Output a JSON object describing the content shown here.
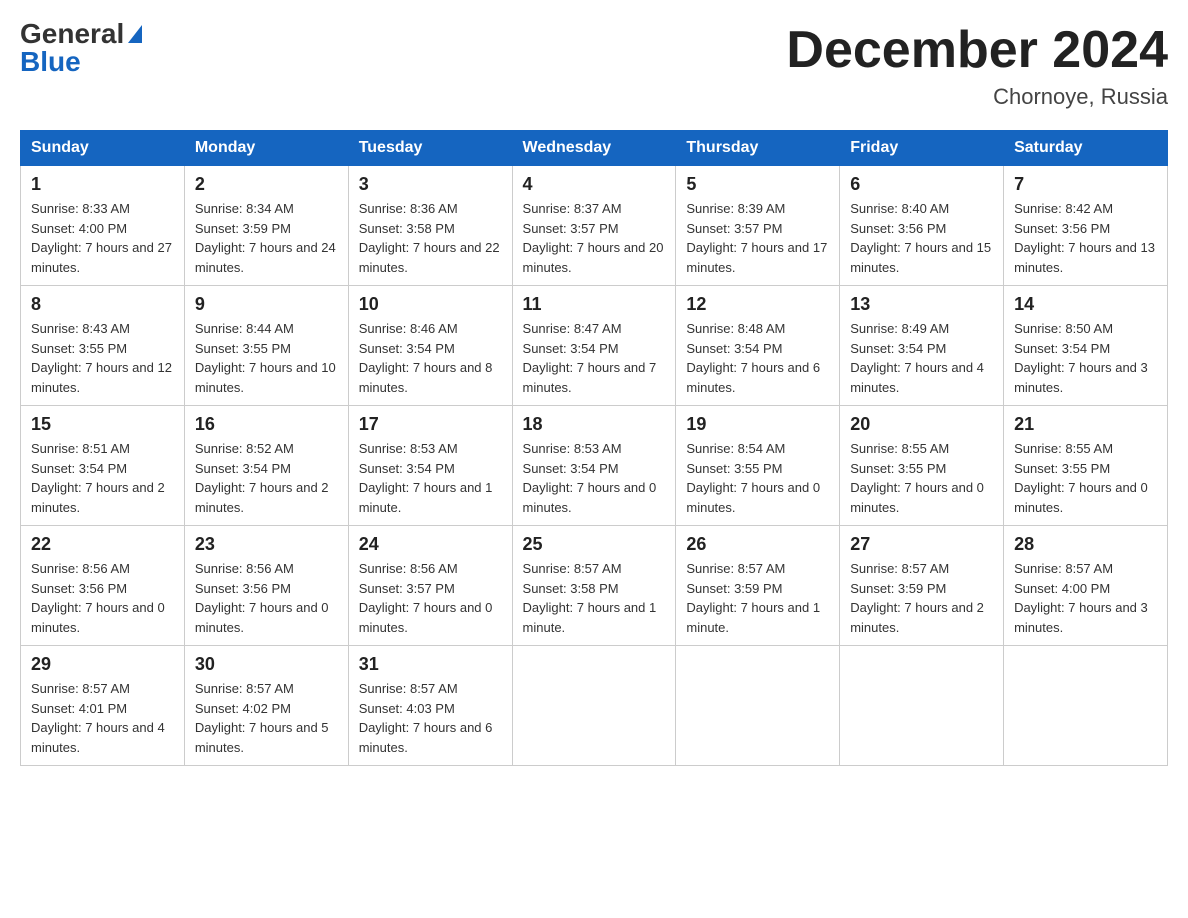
{
  "header": {
    "logo_general": "General",
    "logo_blue": "Blue",
    "title": "December 2024",
    "subtitle": "Chornoye, Russia"
  },
  "days_of_week": [
    "Sunday",
    "Monday",
    "Tuesday",
    "Wednesday",
    "Thursday",
    "Friday",
    "Saturday"
  ],
  "weeks": [
    [
      {
        "day": "1",
        "sunrise": "8:33 AM",
        "sunset": "4:00 PM",
        "daylight": "7 hours and 27 minutes."
      },
      {
        "day": "2",
        "sunrise": "8:34 AM",
        "sunset": "3:59 PM",
        "daylight": "7 hours and 24 minutes."
      },
      {
        "day": "3",
        "sunrise": "8:36 AM",
        "sunset": "3:58 PM",
        "daylight": "7 hours and 22 minutes."
      },
      {
        "day": "4",
        "sunrise": "8:37 AM",
        "sunset": "3:57 PM",
        "daylight": "7 hours and 20 minutes."
      },
      {
        "day": "5",
        "sunrise": "8:39 AM",
        "sunset": "3:57 PM",
        "daylight": "7 hours and 17 minutes."
      },
      {
        "day": "6",
        "sunrise": "8:40 AM",
        "sunset": "3:56 PM",
        "daylight": "7 hours and 15 minutes."
      },
      {
        "day": "7",
        "sunrise": "8:42 AM",
        "sunset": "3:56 PM",
        "daylight": "7 hours and 13 minutes."
      }
    ],
    [
      {
        "day": "8",
        "sunrise": "8:43 AM",
        "sunset": "3:55 PM",
        "daylight": "7 hours and 12 minutes."
      },
      {
        "day": "9",
        "sunrise": "8:44 AM",
        "sunset": "3:55 PM",
        "daylight": "7 hours and 10 minutes."
      },
      {
        "day": "10",
        "sunrise": "8:46 AM",
        "sunset": "3:54 PM",
        "daylight": "7 hours and 8 minutes."
      },
      {
        "day": "11",
        "sunrise": "8:47 AM",
        "sunset": "3:54 PM",
        "daylight": "7 hours and 7 minutes."
      },
      {
        "day": "12",
        "sunrise": "8:48 AM",
        "sunset": "3:54 PM",
        "daylight": "7 hours and 6 minutes."
      },
      {
        "day": "13",
        "sunrise": "8:49 AM",
        "sunset": "3:54 PM",
        "daylight": "7 hours and 4 minutes."
      },
      {
        "day": "14",
        "sunrise": "8:50 AM",
        "sunset": "3:54 PM",
        "daylight": "7 hours and 3 minutes."
      }
    ],
    [
      {
        "day": "15",
        "sunrise": "8:51 AM",
        "sunset": "3:54 PM",
        "daylight": "7 hours and 2 minutes."
      },
      {
        "day": "16",
        "sunrise": "8:52 AM",
        "sunset": "3:54 PM",
        "daylight": "7 hours and 2 minutes."
      },
      {
        "day": "17",
        "sunrise": "8:53 AM",
        "sunset": "3:54 PM",
        "daylight": "7 hours and 1 minute."
      },
      {
        "day": "18",
        "sunrise": "8:53 AM",
        "sunset": "3:54 PM",
        "daylight": "7 hours and 0 minutes."
      },
      {
        "day": "19",
        "sunrise": "8:54 AM",
        "sunset": "3:55 PM",
        "daylight": "7 hours and 0 minutes."
      },
      {
        "day": "20",
        "sunrise": "8:55 AM",
        "sunset": "3:55 PM",
        "daylight": "7 hours and 0 minutes."
      },
      {
        "day": "21",
        "sunrise": "8:55 AM",
        "sunset": "3:55 PM",
        "daylight": "7 hours and 0 minutes."
      }
    ],
    [
      {
        "day": "22",
        "sunrise": "8:56 AM",
        "sunset": "3:56 PM",
        "daylight": "7 hours and 0 minutes."
      },
      {
        "day": "23",
        "sunrise": "8:56 AM",
        "sunset": "3:56 PM",
        "daylight": "7 hours and 0 minutes."
      },
      {
        "day": "24",
        "sunrise": "8:56 AM",
        "sunset": "3:57 PM",
        "daylight": "7 hours and 0 minutes."
      },
      {
        "day": "25",
        "sunrise": "8:57 AM",
        "sunset": "3:58 PM",
        "daylight": "7 hours and 1 minute."
      },
      {
        "day": "26",
        "sunrise": "8:57 AM",
        "sunset": "3:59 PM",
        "daylight": "7 hours and 1 minute."
      },
      {
        "day": "27",
        "sunrise": "8:57 AM",
        "sunset": "3:59 PM",
        "daylight": "7 hours and 2 minutes."
      },
      {
        "day": "28",
        "sunrise": "8:57 AM",
        "sunset": "4:00 PM",
        "daylight": "7 hours and 3 minutes."
      }
    ],
    [
      {
        "day": "29",
        "sunrise": "8:57 AM",
        "sunset": "4:01 PM",
        "daylight": "7 hours and 4 minutes."
      },
      {
        "day": "30",
        "sunrise": "8:57 AM",
        "sunset": "4:02 PM",
        "daylight": "7 hours and 5 minutes."
      },
      {
        "day": "31",
        "sunrise": "8:57 AM",
        "sunset": "4:03 PM",
        "daylight": "7 hours and 6 minutes."
      },
      null,
      null,
      null,
      null
    ]
  ]
}
